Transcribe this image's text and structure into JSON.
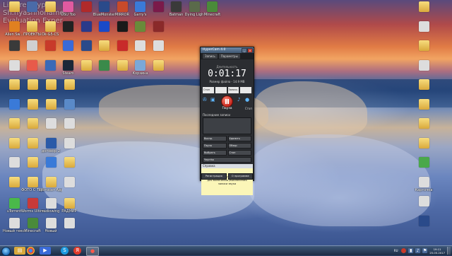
{
  "watermark": {
    "line1": "Listeres.hype",
    "line2": "Sh.nyashnoname.",
    "line3": "Evaluation Exper"
  },
  "desktop_icons": [
    {
      "label": "",
      "color": "#d9a93c",
      "icon": "folder-icon"
    },
    {
      "label": "",
      "color": "#4a6aa8",
      "icon": "app-icon"
    },
    {
      "label": "",
      "color": "#d9a93c",
      "icon": "folder-icon"
    },
    {
      "label": "OSU Too",
      "color": "#e05aa0",
      "icon": "osu-icon"
    },
    {
      "label": "",
      "color": "#b02a2a",
      "icon": "game-icon"
    },
    {
      "label": "BlueMonster",
      "color": "#2a4a8a",
      "icon": "game-icon"
    },
    {
      "label": "MIRROR",
      "color": "#c84a2a",
      "icon": "game-icon"
    },
    {
      "label": "Garry's",
      "color": "#3a7ad8",
      "icon": "garrys-mod-icon"
    },
    {
      "label": "",
      "color": "#7a1a4a",
      "icon": "game-icon"
    },
    {
      "label": "Batman",
      "color": "#3a3a3a",
      "icon": "batman-icon"
    },
    {
      "label": "Dying Ligh",
      "color": "#5a6a4a",
      "icon": "game-icon"
    },
    {
      "label": "Minecraft",
      "color": "#4a8a3a",
      "icon": "minecraft-icon"
    },
    {
      "label": "Alien Sw...",
      "color": "#e08020",
      "icon": "app-icon"
    },
    {
      "label": "ПРОЕКТЫ",
      "color": "#d9a93c",
      "icon": "folder-icon"
    },
    {
      "label": "Ok-G5-CS",
      "color": "#d9a93c",
      "icon": "folder-icon"
    },
    {
      "label": "",
      "color": "#222222",
      "icon": "app-icon"
    },
    {
      "label": "",
      "color": "#2a3a8a",
      "icon": "app-icon"
    },
    {
      "label": "",
      "color": "#1a4ac8",
      "icon": "app-icon"
    },
    {
      "label": "",
      "color": "#1a1a1a",
      "icon": "game-icon"
    },
    {
      "label": "",
      "color": "#6a8a3a",
      "icon": "app-icon"
    },
    {
      "label": "",
      "color": "#8a2a2a",
      "icon": "app-icon"
    },
    {
      "label": "",
      "color": "#3a3a3a",
      "icon": "game-icon"
    },
    {
      "label": "",
      "color": "#d0d0d0",
      "icon": "app-icon"
    },
    {
      "label": "",
      "color": "#c83a2a",
      "icon": "app-icon"
    },
    {
      "label": "",
      "color": "#3a6ad8",
      "icon": "app-icon"
    },
    {
      "label": "",
      "color": "#2a4a8a",
      "icon": "app-icon"
    },
    {
      "label": "",
      "color": "#d9a93c",
      "icon": "folder-icon"
    },
    {
      "label": "",
      "color": "#c82a2a",
      "icon": "app-icon"
    },
    {
      "label": "",
      "color": "#dddddd",
      "icon": "app-icon"
    },
    {
      "label": "",
      "color": "#dddddd",
      "icon": "app-icon"
    },
    {
      "label": "",
      "color": "#dddddd",
      "icon": "app-icon"
    },
    {
      "label": "",
      "color": "#e85a4a",
      "icon": "app-icon"
    },
    {
      "label": "",
      "color": "#3a6ab8",
      "icon": "app-icon"
    },
    {
      "label": "Steam",
      "color": "#1b2838",
      "icon": "steam-icon"
    },
    {
      "label": "",
      "color": "#d9a93c",
      "icon": "folder-icon"
    },
    {
      "label": "",
      "color": "#3a8a4a",
      "icon": "app-icon"
    },
    {
      "label": "",
      "color": "#d9a93c",
      "icon": "folder-icon"
    },
    {
      "label": "Корзина",
      "color": "#7aa8d8",
      "icon": "recycle-bin-icon"
    },
    {
      "label": "",
      "color": "#d9a93c",
      "icon": "folder-icon"
    },
    {
      "label": "",
      "color": "#d9a93c",
      "icon": "folder-icon"
    },
    {
      "label": "",
      "color": "#d9a93c",
      "icon": "folder-icon"
    },
    {
      "label": "",
      "color": "#d9a93c",
      "icon": "folder-icon"
    },
    {
      "label": "",
      "color": "#d9a93c",
      "icon": "folder-icon"
    },
    {
      "label": "",
      "color": "#3a7ad8",
      "icon": "app-icon"
    },
    {
      "label": "",
      "color": "#d9a93c",
      "icon": "folder-icon"
    },
    {
      "label": "",
      "color": "#d9a93c",
      "icon": "folder-icon"
    },
    {
      "label": "",
      "color": "#5a8ac8",
      "icon": "app-icon"
    },
    {
      "label": "",
      "color": "#d9a93c",
      "icon": "folder-icon"
    },
    {
      "label": "",
      "color": "#d9a93c",
      "icon": "folder-icon"
    },
    {
      "label": "",
      "color": "#dddddd",
      "icon": "document-icon"
    },
    {
      "label": "",
      "color": "#dddddd",
      "icon": "document-icon"
    },
    {
      "label": "",
      "color": "#d9a93c",
      "icon": "folder-icon"
    },
    {
      "label": "",
      "color": "#d9a93c",
      "icon": "folder-icon"
    },
    {
      "label": "договор 2",
      "color": "#2a5aa8",
      "icon": "document-icon"
    },
    {
      "label": "",
      "color": "#dddddd",
      "icon": "document-icon"
    },
    {
      "label": "",
      "color": "#dddddd",
      "icon": "document-icon"
    },
    {
      "label": "",
      "color": "#d9a93c",
      "icon": "folder-icon"
    },
    {
      "label": "",
      "color": "#3a7ad8",
      "icon": "app-icon"
    },
    {
      "label": "",
      "color": "#d9a93c",
      "icon": "folder-icon"
    },
    {
      "label": "",
      "color": "#d9a93c",
      "icon": "folder-icon"
    },
    {
      "label": "ФОТО С ТЕЛЕФОНА",
      "color": "#d9a93c",
      "icon": "folder-icon"
    },
    {
      "label": "фотосет Адрианы",
      "color": "#d9a93c",
      "icon": "folder-icon"
    },
    {
      "label": "",
      "color": "#dddddd",
      "icon": "document-icon"
    },
    {
      "label": "uTorrent",
      "color": "#4ab84a",
      "icon": "utorrent-icon"
    },
    {
      "label": "Worms Ultimate",
      "color": "#c83a3a",
      "icon": "game-icon"
    },
    {
      "label": "radiowing",
      "color": "#dddddd",
      "icon": "document-icon"
    },
    {
      "label": "РАДМИР",
      "color": "#d9a93c",
      "icon": "folder-icon"
    },
    {
      "label": "Новый текстовый",
      "color": "#dddddd",
      "icon": "document-icon"
    },
    {
      "label": "Minecraft",
      "color": "#4a8a3a",
      "icon": "minecraft-icon"
    },
    {
      "label": "Новый",
      "color": "#dddddd",
      "icon": "document-icon"
    },
    {
      "label": "",
      "color": "#dddddd",
      "icon": "document-icon"
    },
    {
      "label": "",
      "color": "#d9a93c",
      "icon": "folder-icon"
    },
    {
      "label": "",
      "color": "#dddddd",
      "icon": "document-icon"
    },
    {
      "label": "",
      "color": "#d9a93c",
      "icon": "folder-icon"
    },
    {
      "label": "",
      "color": "#dddddd",
      "icon": "document-icon"
    },
    {
      "label": "",
      "color": "#d9a93c",
      "icon": "folder-icon"
    },
    {
      "label": "",
      "color": "#d9a93c",
      "icon": "folder-icon"
    },
    {
      "label": "",
      "color": "#d9a93c",
      "icon": "folder-icon"
    },
    {
      "label": "",
      "color": "#d9a93c",
      "icon": "folder-icon"
    },
    {
      "label": "",
      "color": "#4aa84a",
      "icon": "app-icon"
    },
    {
      "label": "Карточка",
      "color": "#dddddd",
      "icon": "document-icon"
    },
    {
      "label": "",
      "color": "#dddddd",
      "icon": "document-icon"
    },
    {
      "label": "",
      "color": "#2a4a8a",
      "icon": "app-icon"
    },
    {
      "label": "",
      "color": "#dddddd",
      "icon": "document-icon"
    },
    {
      "label": "",
      "color": "#dddddd",
      "icon": "document-icon"
    }
  ],
  "hypercam": {
    "title": "HyperCam 4.0",
    "tabs": [
      "Запись",
      "Параметры"
    ],
    "duration_label": "Длительность",
    "time": "0:01:17",
    "file_size": "Размер файла - 14.9 МВ",
    "fields": [
      "Стоп",
      "",
      "Запись",
      ""
    ],
    "pause_label": "Пауза",
    "stop_label": "Стоп",
    "list_header": "Последние записи",
    "buttons_row1": [
      "Воспр.",
      "Удалить"
    ],
    "buttons_row2": [
      "Пауза",
      "Обзор"
    ],
    "buttons_row3": [
      "Выбрать",
      "Стоп"
    ],
    "buttons_row4": [
      "Чертёж"
    ],
    "help_header": "Справка",
    "help_text": "Нажмите кнопку \"Запись звука\" для включения /выключения записи звука",
    "bottom_buttons": [
      "Регистрация",
      "О программе"
    ]
  },
  "taskbar": {
    "clock_time": "19:11",
    "clock_date": "25.05.2017",
    "language": "RU"
  }
}
